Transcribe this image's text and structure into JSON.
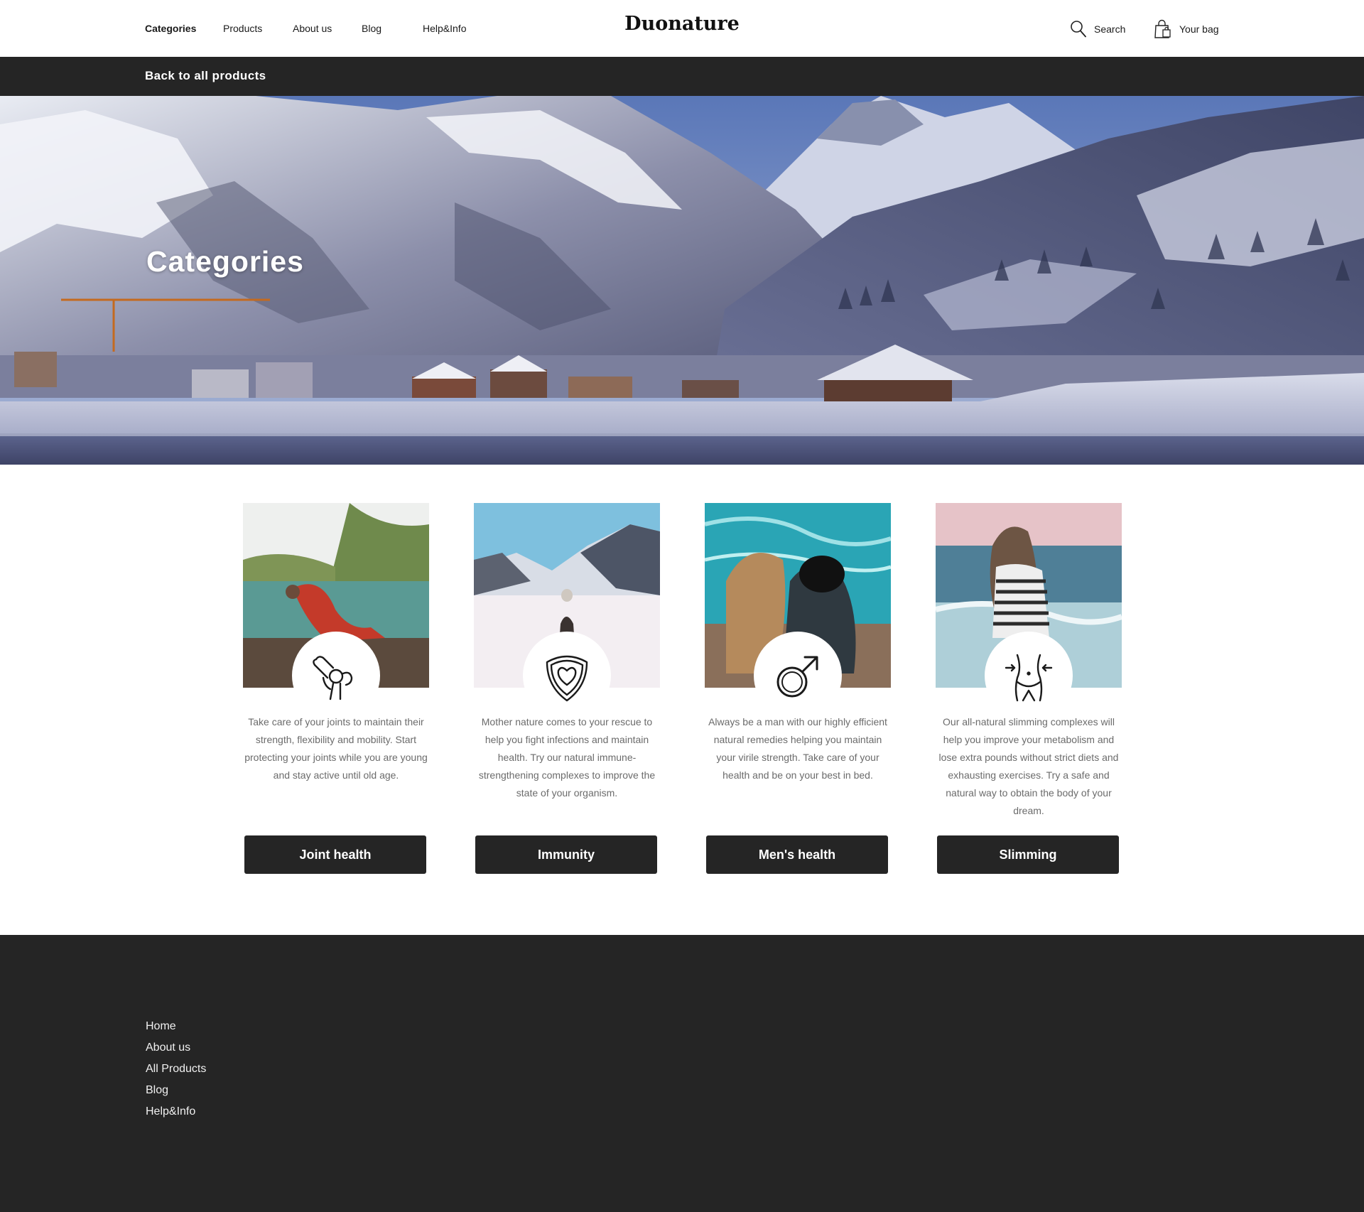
{
  "header": {
    "nav": [
      "Categories",
      "Products",
      "About us",
      "Blog",
      "Help&Info"
    ],
    "active_nav": "Categories",
    "logo": "Duonature",
    "search_label": "Search",
    "bag_label": "Your bag"
  },
  "back_bar": {
    "label": "Back to all products"
  },
  "hero": {
    "title": "Categories"
  },
  "categories": [
    {
      "icon": "joint-icon",
      "description": "Take care of your joints to maintain their strength, flexibility and mobility. Start protecting your joints while you are young and stay active until old age.",
      "button": "Joint health"
    },
    {
      "icon": "heart-shield-icon",
      "description": "Mother nature comes to your rescue to help you fight infections and maintain health. Try our natural immune-strengthening complexes to improve the state of your organism.",
      "button": "Immunity"
    },
    {
      "icon": "male-symbol-icon",
      "description": "Always be a man with our highly efficient natural remedies helping you maintain your virile strength. Take care of your health and be on your best in bed.",
      "button": "Men's health"
    },
    {
      "icon": "waist-icon",
      "description": "Our all-natural slimming complexes will help you improve your metabolism and lose extra pounds without strict diets and exhausting exercises. Try a safe and natural way to obtain the body of your dream.",
      "button": "Slimming"
    }
  ],
  "footer": {
    "links": [
      "Home",
      "About us",
      "All Products",
      "Blog",
      "Help&Info"
    ]
  },
  "colors": {
    "dark": "#252525",
    "text_muted": "#6b6b6b",
    "white": "#ffffff"
  }
}
